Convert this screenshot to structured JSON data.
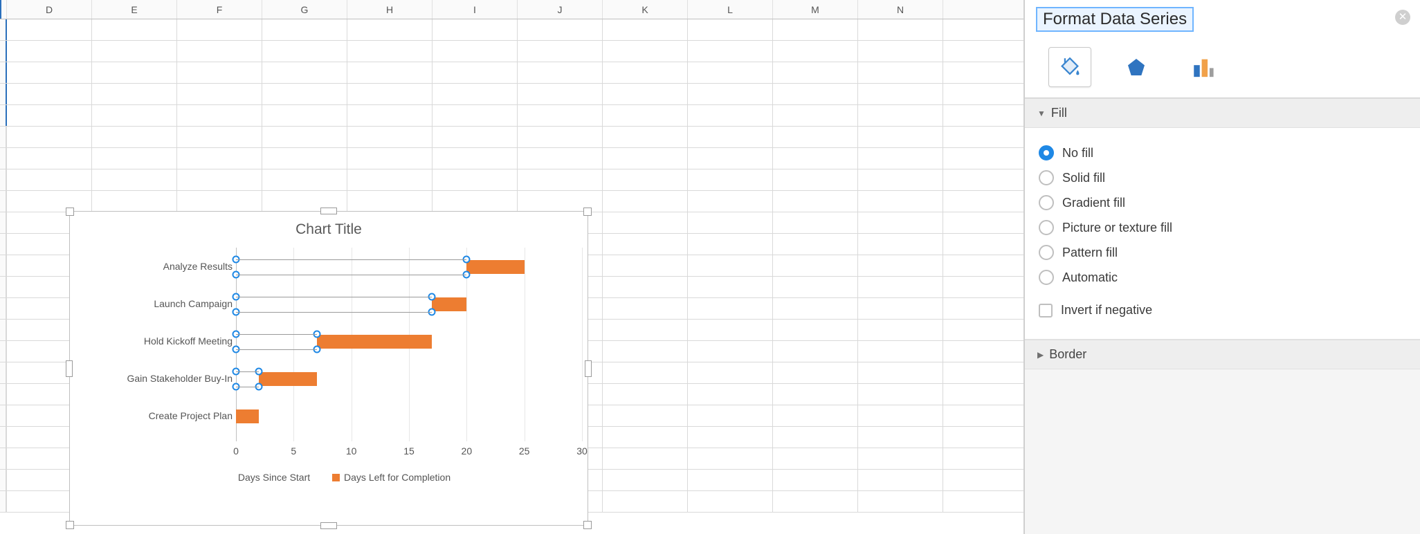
{
  "columns": [
    "D",
    "E",
    "F",
    "G",
    "H",
    "I",
    "J",
    "K",
    "L",
    "M",
    "N"
  ],
  "chart": {
    "title": "Chart Title",
    "legend": {
      "series1": "Days Since Start",
      "series2": "Days Left for Completion"
    },
    "xticks": [
      "0",
      "5",
      "10",
      "15",
      "20",
      "25",
      "30"
    ]
  },
  "chart_data": {
    "type": "bar",
    "orientation": "horizontal",
    "stacked": true,
    "categories": [
      "Analyze Results",
      "Launch Campaign",
      "Hold Kickoff Meeting",
      "Gain Stakeholder Buy-In",
      "Create Project Plan"
    ],
    "series": [
      {
        "name": "Days Since Start",
        "values": [
          20,
          17,
          7,
          2,
          0
        ],
        "fill": "none",
        "selected": true
      },
      {
        "name": "Days Left for Completion",
        "values": [
          5,
          3,
          10,
          5,
          2
        ],
        "fill": "#ed7d31"
      }
    ],
    "title": "Chart Title",
    "xlabel": "",
    "ylabel": "",
    "xlim": [
      0,
      30
    ],
    "xticks": [
      0,
      5,
      10,
      15,
      20,
      25,
      30
    ]
  },
  "pane": {
    "title": "Format Data Series",
    "sections": {
      "fill": "Fill",
      "border": "Border"
    },
    "fill_options": {
      "no_fill": "No fill",
      "solid_fill": "Solid fill",
      "gradient_fill": "Gradient fill",
      "picture_fill": "Picture or texture fill",
      "pattern_fill": "Pattern fill",
      "automatic": "Automatic"
    },
    "invert_label": "Invert if negative",
    "fill_selected": "no_fill"
  }
}
